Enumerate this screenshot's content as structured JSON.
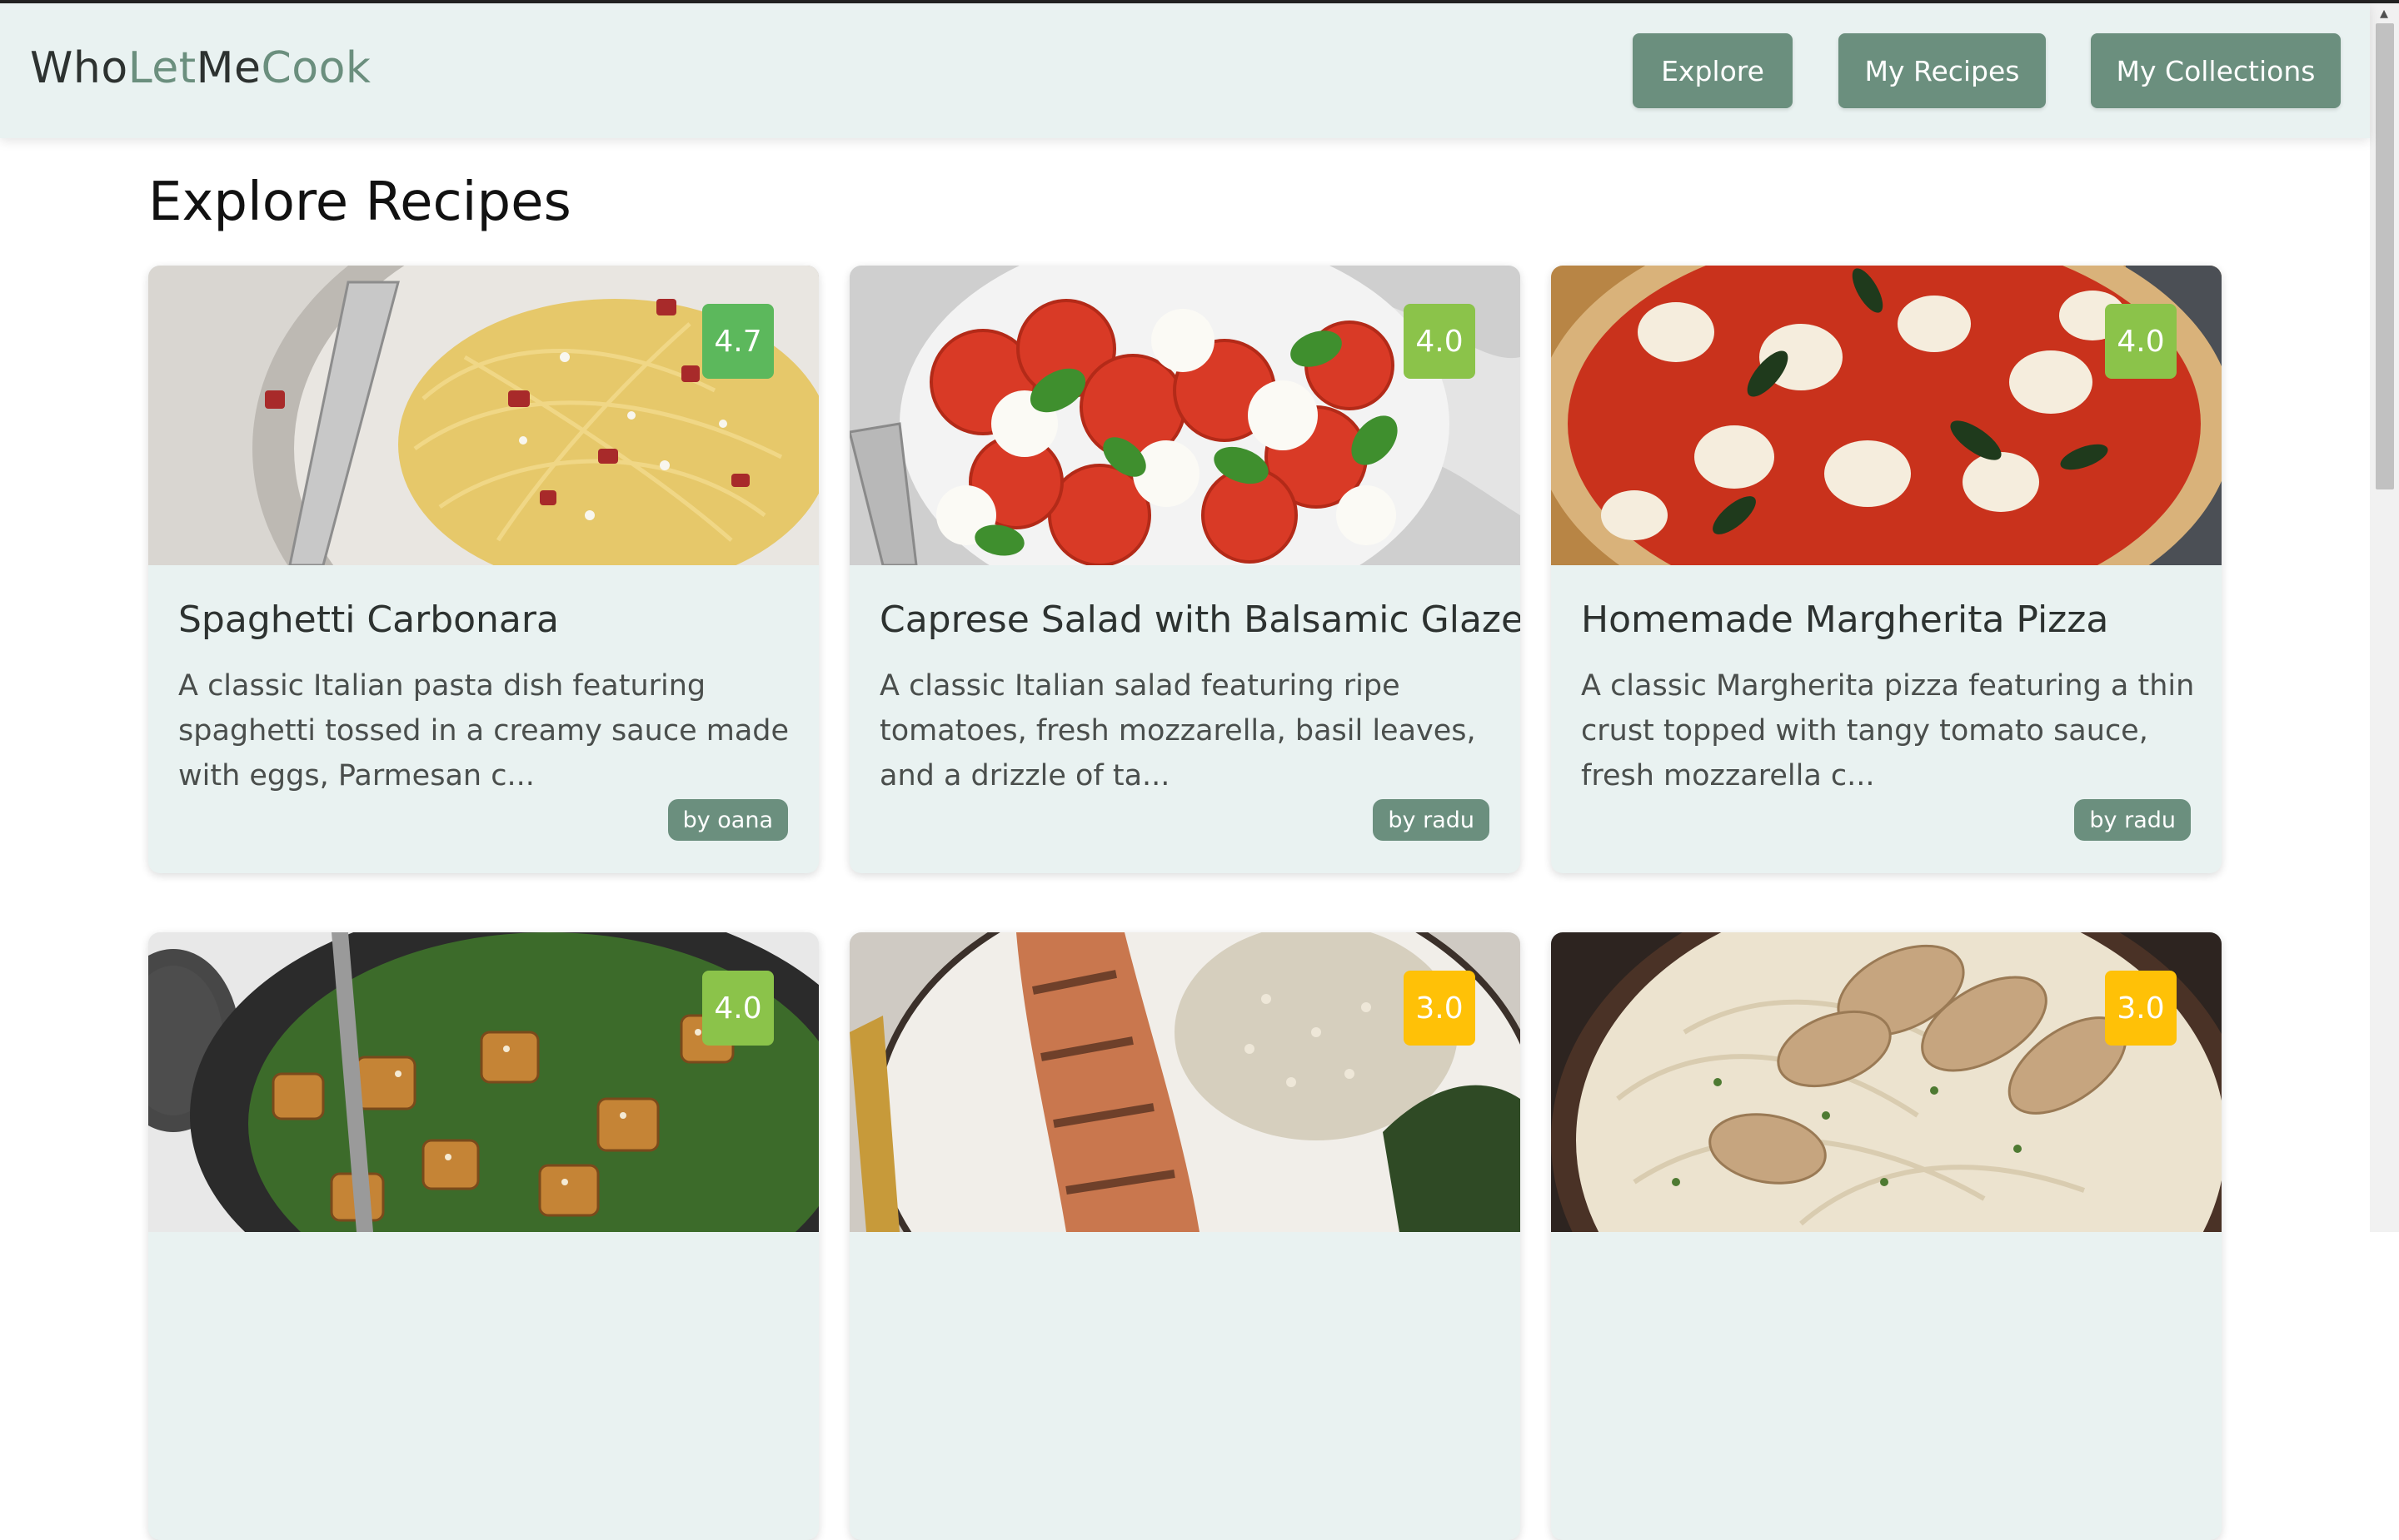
{
  "app": {
    "logo_parts": [
      "Who",
      "Let",
      "Me",
      "Cook"
    ],
    "nav": {
      "explore": "Explore",
      "my_recipes": "My Recipes",
      "my_collections": "My Collections"
    }
  },
  "page": {
    "title": "Explore Recipes"
  },
  "recipes": [
    {
      "title": "Spaghetti Carbonara",
      "description": "A classic Italian pasta dish featuring spaghetti tossed in a creamy sauce made with eggs, Parmesan c...",
      "rating": "4.7",
      "author": "by oana",
      "image": "pasta-carbonara",
      "badge_color": "#5cb85c"
    },
    {
      "title": "Caprese Salad with Balsamic Glaze",
      "description": "A classic Italian salad featuring ripe tomatoes, fresh mozzarella, basil leaves, and a drizzle of ta...",
      "rating": "4.0",
      "author": "by radu",
      "image": "caprese-salad",
      "badge_color": "#8bc34a"
    },
    {
      "title": "Homemade Margherita Pizza",
      "description": "A classic Margherita pizza featuring a thin crust topped with tangy tomato sauce, fresh mozzarella c...",
      "rating": "4.0",
      "author": "by radu",
      "image": "margherita-pizza",
      "badge_color": "#8bc34a"
    },
    {
      "rating": "4.0",
      "image": "tofu-spinach-stirfry",
      "badge_color": "#8bc34a"
    },
    {
      "rating": "3.0",
      "image": "grilled-salmon-rice",
      "badge_color": "#ffc107"
    },
    {
      "rating": "3.0",
      "image": "chicken-alfredo-pasta",
      "badge_color": "#ffc107"
    }
  ],
  "colors": {
    "accent": "#6b8f7e",
    "card_bg": "#e9f2f1",
    "navbar_bg": "#e9f2f1"
  }
}
